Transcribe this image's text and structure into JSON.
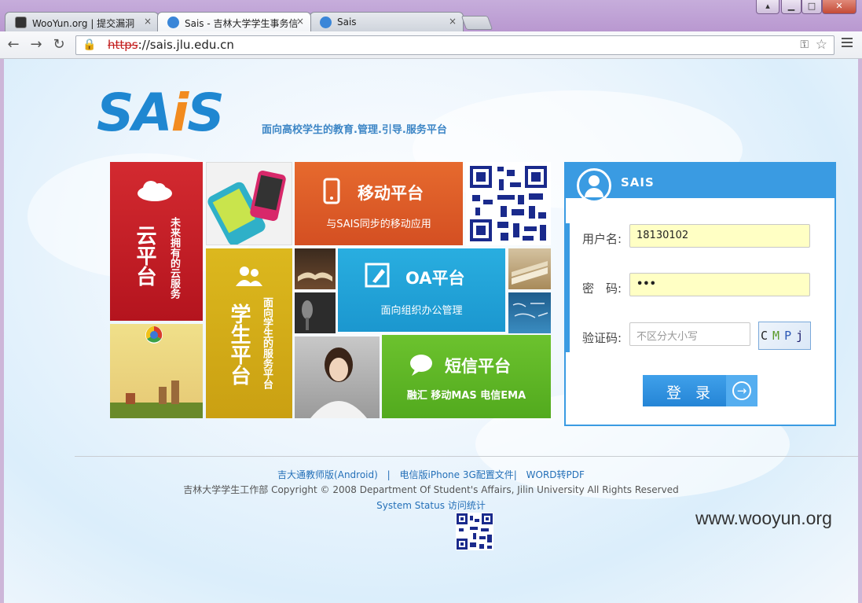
{
  "browser": {
    "tabs": [
      {
        "label": "WooYun.org | 提交漏洞",
        "active": false
      },
      {
        "label": "Sais - 吉林大学学生事务信",
        "active": true
      },
      {
        "label": "Sais",
        "active": false
      }
    ],
    "tab_close_glyph": "×",
    "window_controls": [
      "▴",
      "▁",
      "□",
      "✕"
    ],
    "nav": {
      "back": "←",
      "forward": "→",
      "reload": "↻"
    },
    "url": {
      "scheme": "https",
      "rest": "://sais.jlu.edu.cn"
    }
  },
  "header": {
    "logo_prefix": "SA",
    "logo_i": "i",
    "logo_suffix": "S",
    "slogan": "面向高校学生的教育.管理.引导.服务平台"
  },
  "tiles": {
    "cloud": {
      "title": "云平台",
      "subtitle": "未来拥有的云服务"
    },
    "mobile": {
      "title": "移动平台",
      "subtitle": "与SAIS同步的移动应用"
    },
    "student": {
      "title": "学生平台",
      "subtitle": "面向学生的服务平台"
    },
    "oa": {
      "title": "OA平台",
      "subtitle": "面向组织办公管理"
    },
    "sms": {
      "title": "短信平台",
      "subtitle": "融汇 移动MAS 电信EMA"
    }
  },
  "login": {
    "brand": "SAIS",
    "username_label": "用户名:",
    "username_value": "18130102",
    "password_label": "密　码:",
    "password_value": "•••",
    "captcha_label": "验证码:",
    "captcha_placeholder": "不区分大小写",
    "captcha_chars": [
      "C",
      "M",
      "P",
      "j"
    ],
    "submit_label": "登 录",
    "submit_arrow": "→"
  },
  "footer": {
    "link_android": "吉大通教师版(Android)",
    "sep1": "|",
    "link_iphone": "电信版iPhone 3G配置文件|",
    "link_word": "WORD转PDF",
    "copyright": "吉林大学学生工作部 Copyright © 2008 Department Of Student's Affairs, Jilin University All Rights Reserved",
    "system_status": "System Status",
    "visit_stats": "访问统计"
  },
  "watermark": "www.wooyun.org",
  "colors": {
    "brand_blue": "#3a9be2",
    "cloud_red": "#c8202a",
    "student_gold": "#d8b319",
    "mobile_orange": "#e15d28",
    "oa_blue": "#1fa3d8",
    "sms_green": "#5cb82a"
  }
}
